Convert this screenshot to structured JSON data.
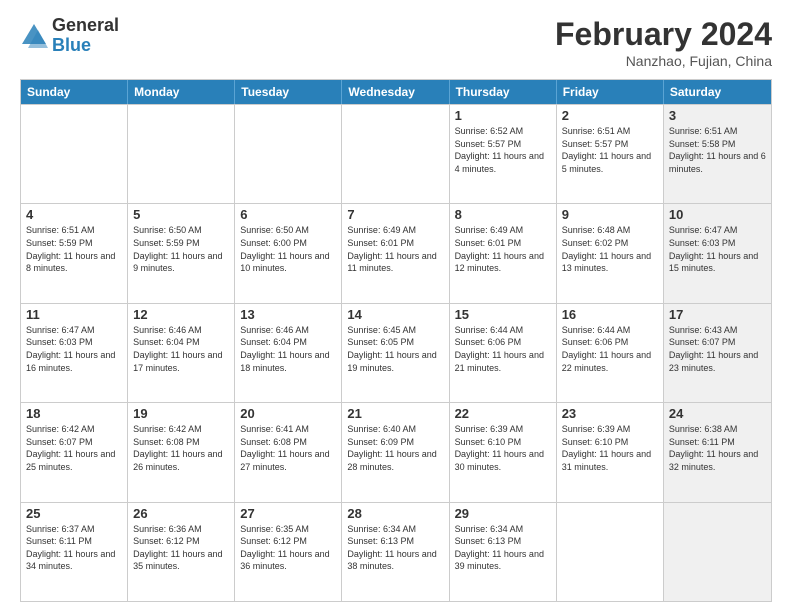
{
  "logo": {
    "general": "General",
    "blue": "Blue"
  },
  "title": {
    "month": "February 2024",
    "location": "Nanzhao, Fujian, China"
  },
  "weekdays": [
    "Sunday",
    "Monday",
    "Tuesday",
    "Wednesday",
    "Thursday",
    "Friday",
    "Saturday"
  ],
  "weeks": [
    [
      {
        "day": "",
        "info": "",
        "shaded": false
      },
      {
        "day": "",
        "info": "",
        "shaded": false
      },
      {
        "day": "",
        "info": "",
        "shaded": false
      },
      {
        "day": "",
        "info": "",
        "shaded": false
      },
      {
        "day": "1",
        "info": "Sunrise: 6:52 AM\nSunset: 5:57 PM\nDaylight: 11 hours and 4 minutes.",
        "shaded": false
      },
      {
        "day": "2",
        "info": "Sunrise: 6:51 AM\nSunset: 5:57 PM\nDaylight: 11 hours and 5 minutes.",
        "shaded": false
      },
      {
        "day": "3",
        "info": "Sunrise: 6:51 AM\nSunset: 5:58 PM\nDaylight: 11 hours and 6 minutes.",
        "shaded": true
      }
    ],
    [
      {
        "day": "4",
        "info": "Sunrise: 6:51 AM\nSunset: 5:59 PM\nDaylight: 11 hours and 8 minutes.",
        "shaded": false
      },
      {
        "day": "5",
        "info": "Sunrise: 6:50 AM\nSunset: 5:59 PM\nDaylight: 11 hours and 9 minutes.",
        "shaded": false
      },
      {
        "day": "6",
        "info": "Sunrise: 6:50 AM\nSunset: 6:00 PM\nDaylight: 11 hours and 10 minutes.",
        "shaded": false
      },
      {
        "day": "7",
        "info": "Sunrise: 6:49 AM\nSunset: 6:01 PM\nDaylight: 11 hours and 11 minutes.",
        "shaded": false
      },
      {
        "day": "8",
        "info": "Sunrise: 6:49 AM\nSunset: 6:01 PM\nDaylight: 11 hours and 12 minutes.",
        "shaded": false
      },
      {
        "day": "9",
        "info": "Sunrise: 6:48 AM\nSunset: 6:02 PM\nDaylight: 11 hours and 13 minutes.",
        "shaded": false
      },
      {
        "day": "10",
        "info": "Sunrise: 6:47 AM\nSunset: 6:03 PM\nDaylight: 11 hours and 15 minutes.",
        "shaded": true
      }
    ],
    [
      {
        "day": "11",
        "info": "Sunrise: 6:47 AM\nSunset: 6:03 PM\nDaylight: 11 hours and 16 minutes.",
        "shaded": false
      },
      {
        "day": "12",
        "info": "Sunrise: 6:46 AM\nSunset: 6:04 PM\nDaylight: 11 hours and 17 minutes.",
        "shaded": false
      },
      {
        "day": "13",
        "info": "Sunrise: 6:46 AM\nSunset: 6:04 PM\nDaylight: 11 hours and 18 minutes.",
        "shaded": false
      },
      {
        "day": "14",
        "info": "Sunrise: 6:45 AM\nSunset: 6:05 PM\nDaylight: 11 hours and 19 minutes.",
        "shaded": false
      },
      {
        "day": "15",
        "info": "Sunrise: 6:44 AM\nSunset: 6:06 PM\nDaylight: 11 hours and 21 minutes.",
        "shaded": false
      },
      {
        "day": "16",
        "info": "Sunrise: 6:44 AM\nSunset: 6:06 PM\nDaylight: 11 hours and 22 minutes.",
        "shaded": false
      },
      {
        "day": "17",
        "info": "Sunrise: 6:43 AM\nSunset: 6:07 PM\nDaylight: 11 hours and 23 minutes.",
        "shaded": true
      }
    ],
    [
      {
        "day": "18",
        "info": "Sunrise: 6:42 AM\nSunset: 6:07 PM\nDaylight: 11 hours and 25 minutes.",
        "shaded": false
      },
      {
        "day": "19",
        "info": "Sunrise: 6:42 AM\nSunset: 6:08 PM\nDaylight: 11 hours and 26 minutes.",
        "shaded": false
      },
      {
        "day": "20",
        "info": "Sunrise: 6:41 AM\nSunset: 6:08 PM\nDaylight: 11 hours and 27 minutes.",
        "shaded": false
      },
      {
        "day": "21",
        "info": "Sunrise: 6:40 AM\nSunset: 6:09 PM\nDaylight: 11 hours and 28 minutes.",
        "shaded": false
      },
      {
        "day": "22",
        "info": "Sunrise: 6:39 AM\nSunset: 6:10 PM\nDaylight: 11 hours and 30 minutes.",
        "shaded": false
      },
      {
        "day": "23",
        "info": "Sunrise: 6:39 AM\nSunset: 6:10 PM\nDaylight: 11 hours and 31 minutes.",
        "shaded": false
      },
      {
        "day": "24",
        "info": "Sunrise: 6:38 AM\nSunset: 6:11 PM\nDaylight: 11 hours and 32 minutes.",
        "shaded": true
      }
    ],
    [
      {
        "day": "25",
        "info": "Sunrise: 6:37 AM\nSunset: 6:11 PM\nDaylight: 11 hours and 34 minutes.",
        "shaded": false
      },
      {
        "day": "26",
        "info": "Sunrise: 6:36 AM\nSunset: 6:12 PM\nDaylight: 11 hours and 35 minutes.",
        "shaded": false
      },
      {
        "day": "27",
        "info": "Sunrise: 6:35 AM\nSunset: 6:12 PM\nDaylight: 11 hours and 36 minutes.",
        "shaded": false
      },
      {
        "day": "28",
        "info": "Sunrise: 6:34 AM\nSunset: 6:13 PM\nDaylight: 11 hours and 38 minutes.",
        "shaded": false
      },
      {
        "day": "29",
        "info": "Sunrise: 6:34 AM\nSunset: 6:13 PM\nDaylight: 11 hours and 39 minutes.",
        "shaded": false
      },
      {
        "day": "",
        "info": "",
        "shaded": false
      },
      {
        "day": "",
        "info": "",
        "shaded": true
      }
    ]
  ]
}
